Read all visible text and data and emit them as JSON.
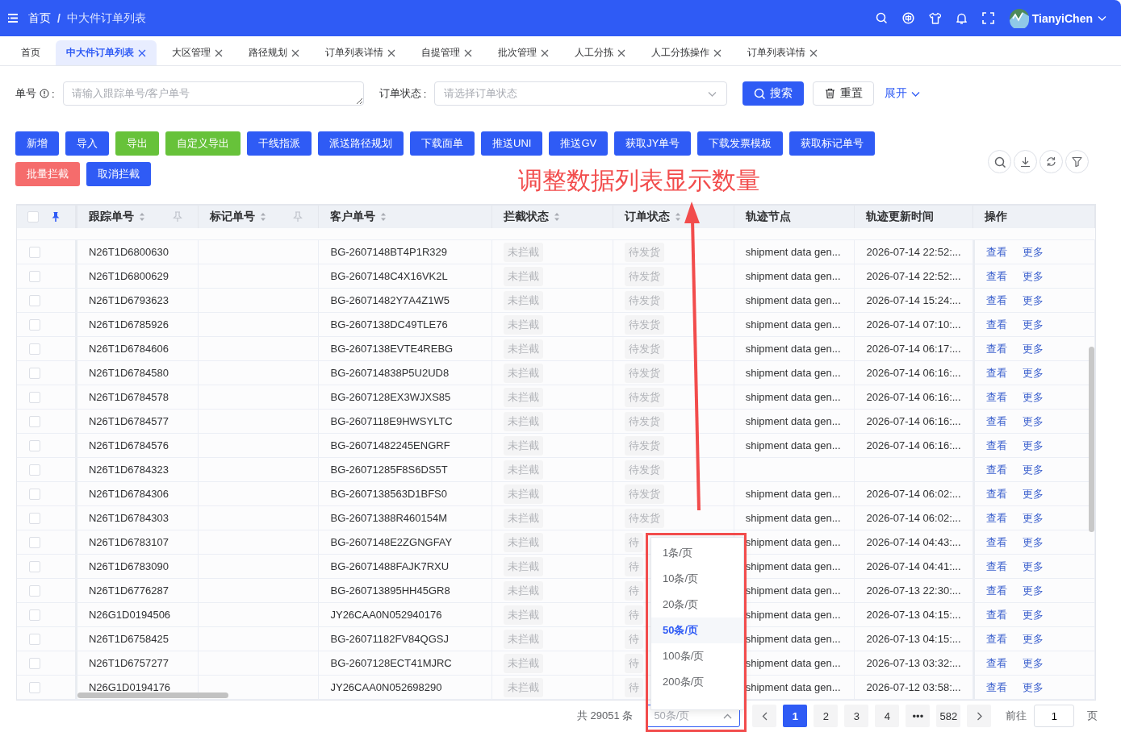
{
  "header": {
    "breadcrumb": [
      "首页",
      "中大件订单列表"
    ],
    "breadcrumb_separator": "/",
    "user": "TianyiChen"
  },
  "tabs": [
    {
      "label": "首页",
      "selected": false,
      "closable": false
    },
    {
      "label": "中大件订单列表",
      "selected": true,
      "closable": true
    },
    {
      "label": "大区管理",
      "selected": false,
      "closable": true
    },
    {
      "label": "路径规划",
      "selected": false,
      "closable": true
    },
    {
      "label": "订单列表详情",
      "selected": false,
      "closable": true
    },
    {
      "label": "自提管理",
      "selected": false,
      "closable": true
    },
    {
      "label": "批次管理",
      "selected": false,
      "closable": true
    },
    {
      "label": "人工分拣",
      "selected": false,
      "closable": true
    },
    {
      "label": "人工分拣操作",
      "selected": false,
      "closable": true
    },
    {
      "label": "订单列表详情",
      "selected": false,
      "closable": true
    }
  ],
  "filters": [
    {
      "kind": "textarea",
      "label": "单号",
      "info": true,
      "colon": ":",
      "placeholder": "请输入跟踪单号/客户单号"
    },
    {
      "kind": "select",
      "label": "订单状态",
      "info": false,
      "colon": ":",
      "placeholder": "请选择订单状态"
    }
  ],
  "search_button": "搜索",
  "reset_button": "重置",
  "expand_link": "展开",
  "actions": [
    {
      "label": "新增",
      "kind": "primary"
    },
    {
      "label": "导入",
      "kind": "primary"
    },
    {
      "label": "导出",
      "kind": "success"
    },
    {
      "label": "自定义导出",
      "kind": "success"
    },
    {
      "label": "干线指派",
      "kind": "primary"
    },
    {
      "label": "派送路径规划",
      "kind": "primary"
    },
    {
      "label": "下载面单",
      "kind": "primary"
    },
    {
      "label": "推送UNI",
      "kind": "primary"
    },
    {
      "label": "推送GV",
      "kind": "primary"
    },
    {
      "label": "获取JY单号",
      "kind": "primary"
    },
    {
      "label": "下载发票模板",
      "kind": "primary"
    },
    {
      "label": "获取标记单号",
      "kind": "primary"
    },
    {
      "label": "批量拦截",
      "kind": "danger"
    },
    {
      "label": "取消拦截",
      "kind": "primary"
    }
  ],
  "table": {
    "columns": [
      {
        "kind": "select",
        "checked": false,
        "pinned": true
      },
      {
        "kind": "text",
        "title": "跟踪单号",
        "sortable": true,
        "pinned": false
      },
      {
        "kind": "text",
        "title": "标记单号",
        "sortable": true,
        "pinned": false
      },
      {
        "kind": "text",
        "title": "客户单号",
        "sortable": true
      },
      {
        "kind": "text",
        "title": "拦截状态",
        "sortable": true
      },
      {
        "kind": "text",
        "title": "订单状态",
        "sortable": true
      },
      {
        "kind": "text",
        "title": "轨迹节点",
        "sortable": false
      },
      {
        "kind": "text",
        "title": "轨迹更新时间",
        "sortable": false
      },
      {
        "kind": "text",
        "title": "操作",
        "sortable": false
      }
    ],
    "rows": [
      {
        "checked": false,
        "tracking": "N26T1D6800630",
        "customer": "BG-2607148BT4P1R329",
        "intercept": "未拦截",
        "status": "待发货",
        "node": "shipment data gen...",
        "updated": "2026-07-14 22:52:...",
        "ops": [
          "查看",
          "更多"
        ]
      },
      {
        "checked": false,
        "tracking": "N26T1D6800629",
        "customer": "BG-2607148C4X16VK2L",
        "intercept": "未拦截",
        "status": "待发货",
        "node": "shipment data gen...",
        "updated": "2026-07-14 22:52:...",
        "ops": [
          "查看",
          "更多"
        ]
      },
      {
        "checked": false,
        "tracking": "N26T1D6793623",
        "customer": "BG-26071482Y7A4Z1W5",
        "intercept": "未拦截",
        "status": "待发货",
        "node": "shipment data gen...",
        "updated": "2026-07-14 15:24:...",
        "ops": [
          "查看",
          "更多"
        ]
      },
      {
        "checked": false,
        "tracking": "N26T1D6785926",
        "customer": "BG-2607138DC49TLE76",
        "intercept": "未拦截",
        "status": "待发货",
        "node": "shipment data gen...",
        "updated": "2026-07-14 07:10:...",
        "ops": [
          "查看",
          "更多"
        ]
      },
      {
        "checked": false,
        "tracking": "N26T1D6784606",
        "customer": "BG-2607138EVTE4REBG",
        "intercept": "未拦截",
        "status": "待发货",
        "node": "shipment data gen...",
        "updated": "2026-07-14 06:17:...",
        "ops": [
          "查看",
          "更多"
        ]
      },
      {
        "checked": false,
        "tracking": "N26T1D6784580",
        "customer": "BG-260714838P5U2UD8",
        "intercept": "未拦截",
        "status": "待发货",
        "node": "shipment data gen...",
        "updated": "2026-07-14 06:16:...",
        "ops": [
          "查看",
          "更多"
        ]
      },
      {
        "checked": false,
        "tracking": "N26T1D6784578",
        "customer": "BG-2607128EX3WJXS85",
        "intercept": "未拦截",
        "status": "待发货",
        "node": "shipment data gen...",
        "updated": "2026-07-14 06:16:...",
        "ops": [
          "查看",
          "更多"
        ]
      },
      {
        "checked": false,
        "tracking": "N26T1D6784577",
        "customer": "BG-2607118E9HWSYLTC",
        "intercept": "未拦截",
        "status": "待发货",
        "node": "shipment data gen...",
        "updated": "2026-07-14 06:16:...",
        "ops": [
          "查看",
          "更多"
        ]
      },
      {
        "checked": false,
        "tracking": "N26T1D6784576",
        "customer": "BG-26071482245ENGRF",
        "intercept": "未拦截",
        "status": "待发货",
        "node": "shipment data gen...",
        "updated": "2026-07-14 06:16:...",
        "ops": [
          "查看",
          "更多"
        ]
      },
      {
        "checked": false,
        "tracking": "N26T1D6784323",
        "customer": "BG-26071285F8S6DS5T",
        "intercept": "未拦截",
        "status": "待发货",
        "ops": [
          "查看",
          "更多"
        ]
      },
      {
        "checked": false,
        "tracking": "N26T1D6784306",
        "customer": "BG-2607138563D1BFS0",
        "intercept": "未拦截",
        "status": "待发货",
        "node": "shipment data gen...",
        "updated": "2026-07-14 06:02:...",
        "ops": [
          "查看",
          "更多"
        ]
      },
      {
        "checked": false,
        "tracking": "N26T1D6784303",
        "customer": "BG-26071388R460154M",
        "intercept": "未拦截",
        "status": "待发货",
        "node": "shipment data gen...",
        "updated": "2026-07-14 06:02:...",
        "ops": [
          "查看",
          "更多"
        ]
      },
      {
        "checked": false,
        "tracking": "N26T1D6783107",
        "customer": "BG-2607148E2ZGNGFAY",
        "intercept": "未拦截",
        "status": "待",
        "node": "shipment data gen...",
        "updated": "2026-07-14 04:43:...",
        "ops": [
          "查看",
          "更多"
        ]
      },
      {
        "checked": false,
        "tracking": "N26T1D6783090",
        "customer": "BG-26071488FAJK7RXU",
        "intercept": "未拦截",
        "status": "待",
        "node": "shipment data gen...",
        "updated": "2026-07-14 04:41:...",
        "ops": [
          "查看",
          "更多"
        ]
      },
      {
        "checked": false,
        "tracking": "N26T1D6776287",
        "customer": "BG-260713895HH45GR8",
        "intercept": "未拦截",
        "status": "待",
        "node": "shipment data gen...",
        "updated": "2026-07-13 22:30:...",
        "ops": [
          "查看",
          "更多"
        ]
      },
      {
        "checked": false,
        "tracking": "N26G1D0194506",
        "customer": "JY26CAA0N052940176",
        "intercept": "未拦截",
        "status": "待",
        "node": "shipment data gen...",
        "updated": "2026-07-13 04:15:...",
        "ops": [
          "查看",
          "更多"
        ]
      },
      {
        "checked": false,
        "tracking": "N26T1D6758425",
        "customer": "BG-26071182FV84QGSJ",
        "intercept": "未拦截",
        "status": "待",
        "node": "shipment data gen...",
        "updated": "2026-07-13 04:15:...",
        "ops": [
          "查看",
          "更多"
        ]
      },
      {
        "checked": false,
        "tracking": "N26T1D6757277",
        "customer": "BG-2607128ECT41MJRC",
        "intercept": "未拦截",
        "status": "待",
        "node": "shipment data gen...",
        "updated": "2026-07-13 03:32:...",
        "ops": [
          "查看",
          "更多"
        ]
      },
      {
        "checked": false,
        "tracking": "N26G1D0194176",
        "customer": "JY26CAA0N052698290",
        "intercept": "未拦截",
        "status": "待",
        "node": "shipment data gen...",
        "updated": "2026-07-12 03:58:...",
        "ops": [
          "查看",
          "更多"
        ]
      }
    ]
  },
  "pagination": {
    "total": "共 29051 条",
    "page_size": "50条/页",
    "pages": [
      {
        "label": "1",
        "selected": true
      },
      {
        "label": "2",
        "selected": false
      },
      {
        "label": "3",
        "selected": false
      },
      {
        "label": "4",
        "selected": false
      },
      {
        "label": "•••",
        "selected": false
      },
      {
        "label": "582",
        "selected": false
      }
    ],
    "goto_label": "前往",
    "goto_value": "1",
    "page_unit": "页"
  },
  "page_size_menu": [
    {
      "label": "1条/页",
      "selected": false
    },
    {
      "label": "10条/页",
      "selected": false
    },
    {
      "label": "20条/页",
      "selected": false
    },
    {
      "label": "50条/页",
      "selected": true
    },
    {
      "label": "100条/页",
      "selected": false
    },
    {
      "label": "200条/页",
      "selected": false
    }
  ],
  "annotation": {
    "text": "调整数据列表显示数量"
  }
}
